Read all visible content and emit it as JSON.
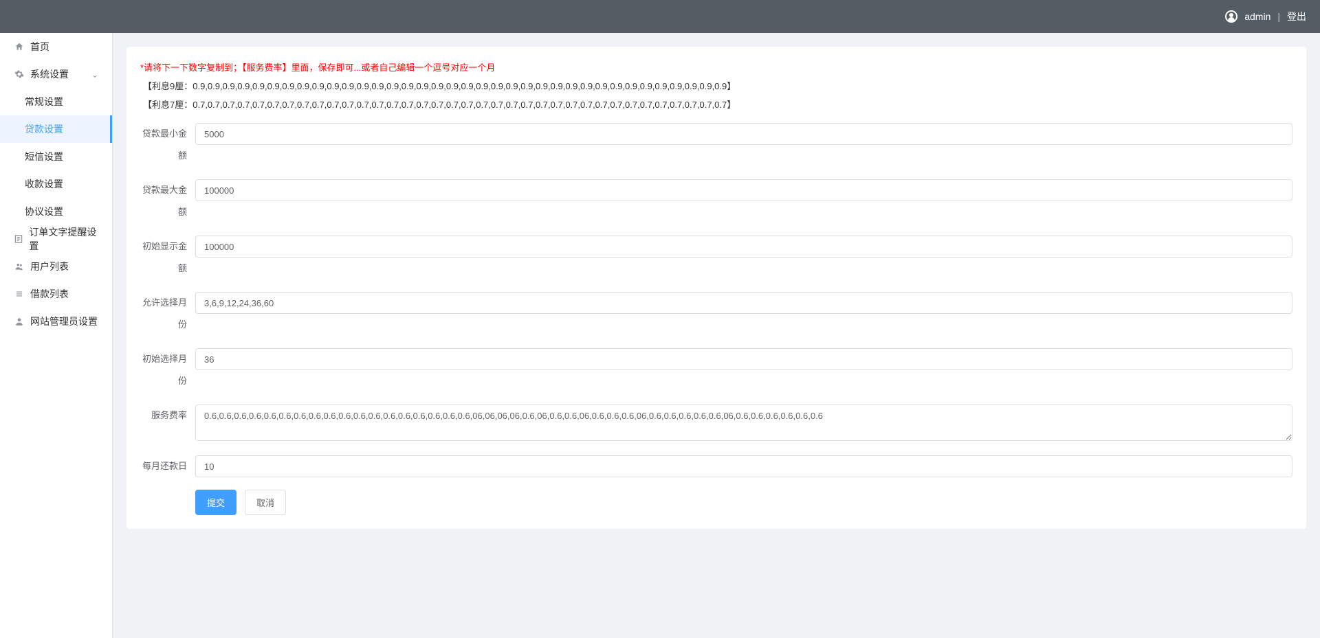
{
  "header": {
    "username": "admin",
    "logout": "登出"
  },
  "sidebar": {
    "home": "首页",
    "system_settings": "系统设置",
    "sub": {
      "general": "常规设置",
      "loan": "贷款设置",
      "sms": "短信设置",
      "payment": "收款设置",
      "agreement": "协议设置"
    },
    "order_text": "订单文字提醒设置",
    "user_list": "用户列表",
    "loan_list": "借款列表",
    "admin_settings": "网站管理员设置"
  },
  "hints": {
    "main": "*请将下一下数字复制到；【服务费率】里面，保存即可...或者自己编辑一个逗号对应一个月",
    "rate9": "【利息9厘：0.9,0.9,0.9,0.9,0.9,0.9,0.9,0.9,0.9,0.9,0.9,0.9,0.9,0.9,0.9,0.9,0.9,0.9,0.9,0.9,0.9,0.9,0.9,0.9,0.9,0.9,0.9,0.9,0.9,0.9,0.9,0.9,0.9,0.9,0.9,0.9】",
    "rate7": "【利息7厘：0.7,0.7,0.7,0.7,0.7,0.7,0.7,0.7,0.7,0.7,0.7,0.7,0.7,0.7,0.7,0.7,0.7,0.7,0.7,0.7,0.7,0.7,0.7,0.7,0.7,0.7,0.7,0.7,0.7,0.7,0.7,0.7,0.7,0.7,0.7,0.7】"
  },
  "form": {
    "min_amount": {
      "label": "贷款最小金额",
      "value": "5000"
    },
    "max_amount": {
      "label": "贷款最大金额",
      "value": "100000"
    },
    "initial_amount": {
      "label": "初始显示金额",
      "value": "100000"
    },
    "allowed_months": {
      "label": "允许选择月份",
      "value": "3,6,9,12,24,36,60"
    },
    "initial_month": {
      "label": "初始选择月份",
      "value": "36"
    },
    "service_rate": {
      "label": "服务费率",
      "value": "0.6,0.6,0.6,0.6,0.6,0.6,0.6,0.6,0.6,0.6,0.6,0.6,0.6,0.6,0.6,0.6,0.6,0.6,06,06,06,06,0.6,06,0.6,0.6,06,0.6,0.6,0.6,06,0.6,0.6,0.6,0.6,0.6,06,0.6,0.6,0.6,0.6,0.6,0.6"
    },
    "repay_day": {
      "label": "每月还款日",
      "value": "10"
    },
    "submit": "提交",
    "cancel": "取消"
  }
}
